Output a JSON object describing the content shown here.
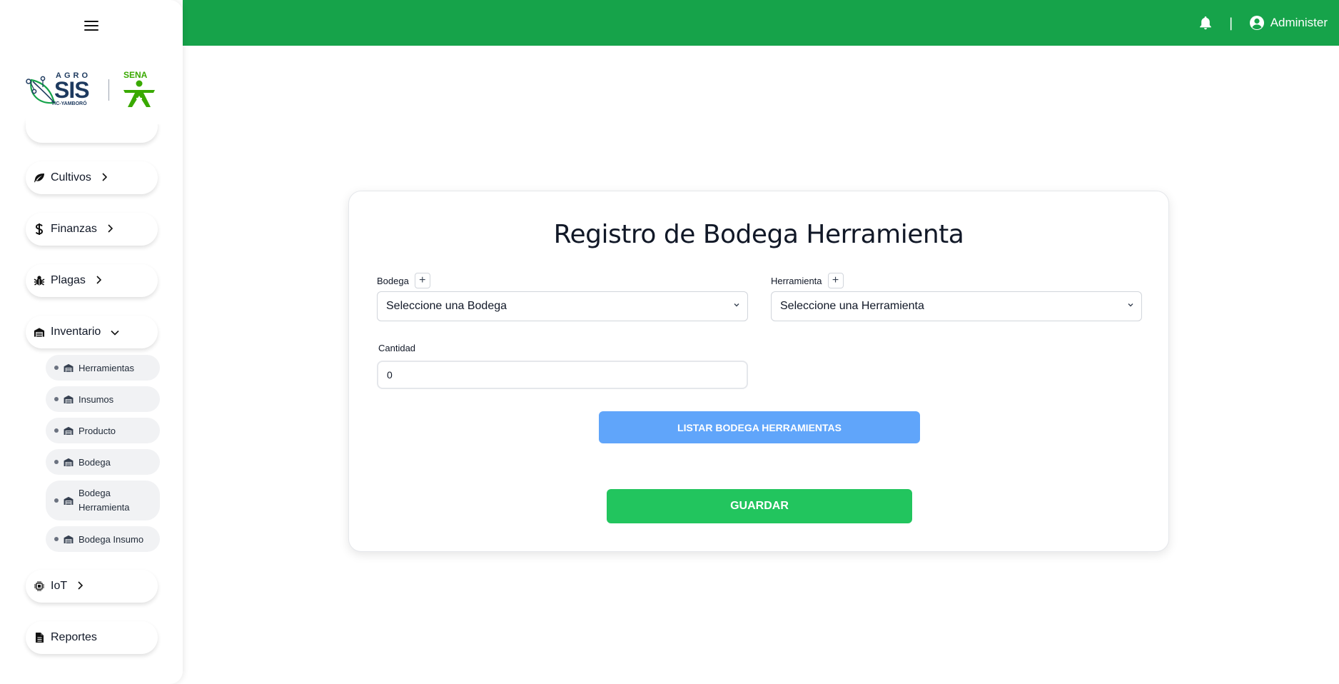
{
  "header": {
    "user_name": "Administer",
    "separator": "|"
  },
  "sidebar": {
    "logo": {
      "agro": "AGRO",
      "sis": "SIS",
      "tic": "TIC-YAMBORÓ",
      "sena": "SENA"
    },
    "items": [
      {
        "label": "Cultivos",
        "icon": "leaf-icon"
      },
      {
        "label": "Finanzas",
        "icon": "dollar-icon"
      },
      {
        "label": "Plagas",
        "icon": "bug-icon"
      },
      {
        "label": "Inventario",
        "icon": "warehouse-icon",
        "expanded": true
      },
      {
        "label": "IoT",
        "icon": "chip-icon"
      },
      {
        "label": "Reportes",
        "icon": "file-icon"
      }
    ],
    "inventario_sub": [
      {
        "label": "Herramientas"
      },
      {
        "label": "Insumos"
      },
      {
        "label": "Producto"
      },
      {
        "label": "Bodega"
      },
      {
        "label": "Bodega Herramienta"
      },
      {
        "label": "Bodega Insumo"
      }
    ]
  },
  "form": {
    "title": "Registro de Bodega Herramienta",
    "bodega_label": "Bodega",
    "bodega_placeholder": "Seleccione una Bodega",
    "herramienta_label": "Herramienta",
    "herramienta_placeholder": "Seleccione una Herramienta",
    "cantidad_label": "Cantidad",
    "cantidad_value": "0",
    "list_button": "LISTAR BODEGA HERRAMIENTAS",
    "save_button": "GUARDAR",
    "plus": "+"
  },
  "colors": {
    "topbar": "#16a34a",
    "list_button": "#60a5fa",
    "save_button": "#22c55e"
  }
}
